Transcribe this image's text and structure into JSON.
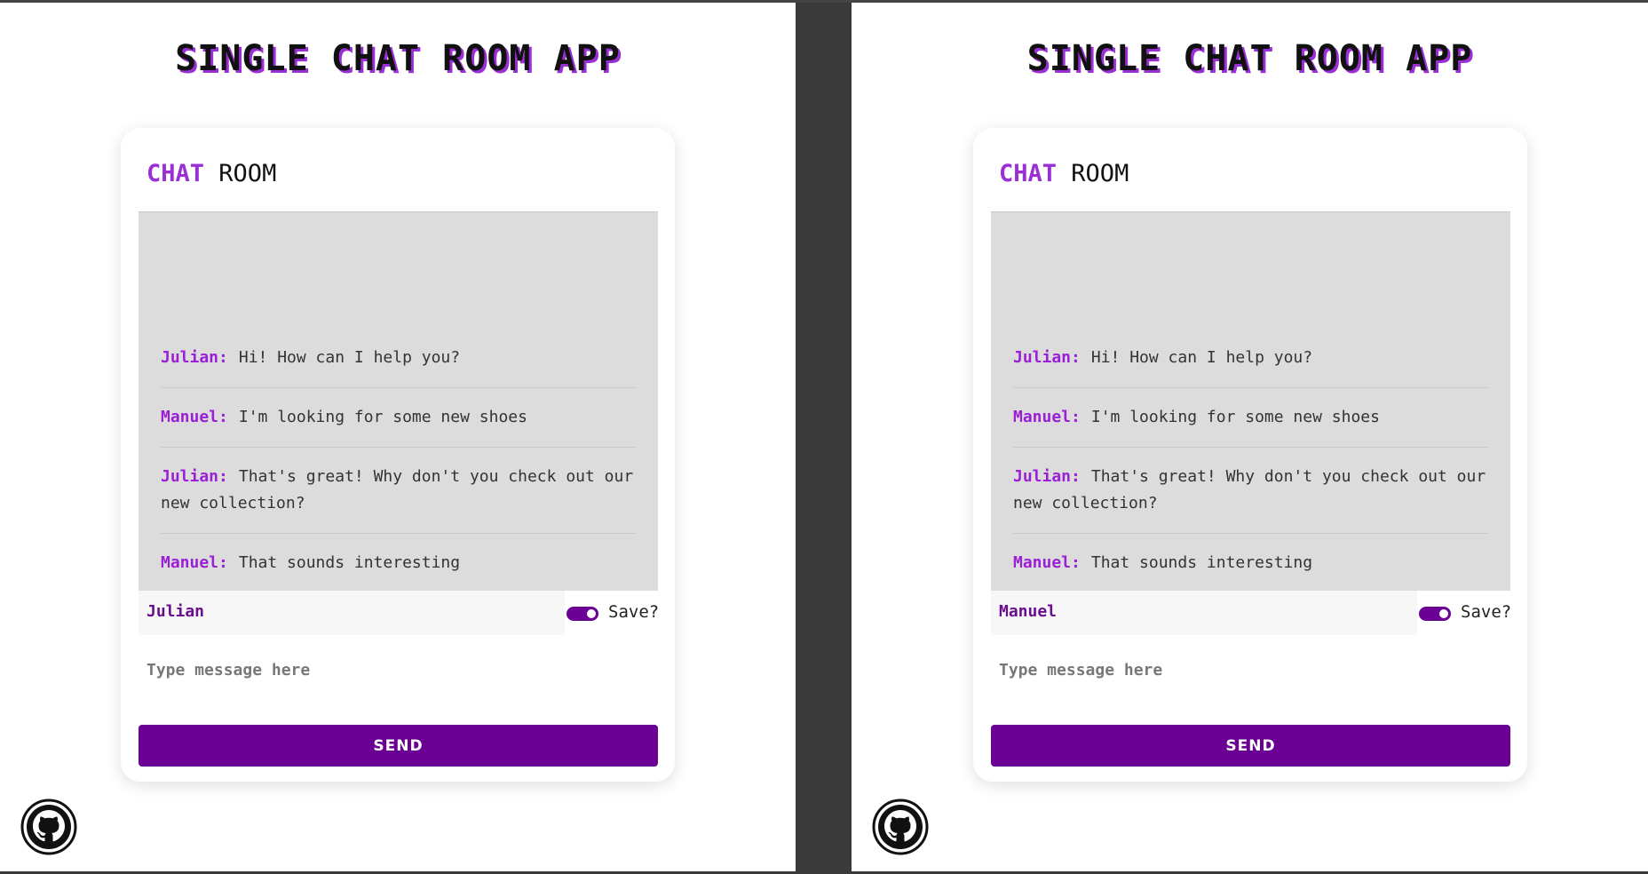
{
  "app_title": "SINGLE CHAT ROOM APP",
  "header": {
    "accent": "CHAT",
    "rest": "ROOM"
  },
  "messages": [
    {
      "author": "Julian:",
      "text": "Hi! How can I help you?"
    },
    {
      "author": "Manuel:",
      "text": "I'm looking for some new shoes"
    },
    {
      "author": "Julian:",
      "text": "That's great! Why don't you check out our new collection?"
    },
    {
      "author": "Manuel:",
      "text": "That sounds interesting"
    }
  ],
  "left": {
    "username": "Julian"
  },
  "right": {
    "username": "Manuel"
  },
  "save_label": "Save?",
  "save_enabled": true,
  "message_placeholder": "Type message here",
  "send_label": "SEND",
  "icons": {
    "footer": "github-icon"
  },
  "colors": {
    "accent": "#9b2fd6",
    "button": "#6b0094",
    "messages_bg": "#dcdcdc"
  }
}
